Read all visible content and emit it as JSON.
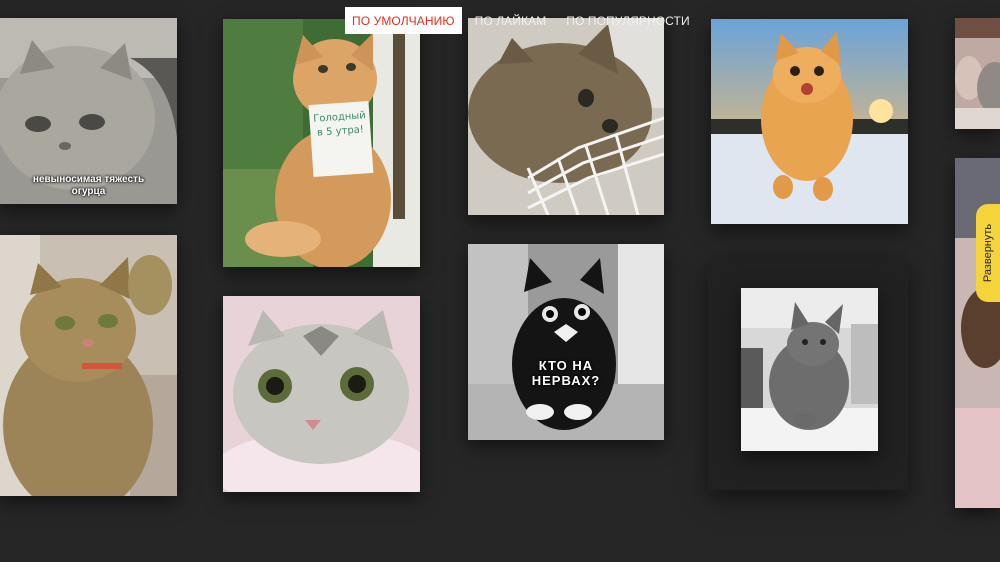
{
  "sort_tabs": [
    {
      "label": "ПО УМОЛЧАНИЮ",
      "active": true
    },
    {
      "label": "ПО ЛАЙКАМ",
      "active": false
    },
    {
      "label": "ПО ПОПУЛЯРНОСТИ",
      "active": false
    }
  ],
  "tiles": {
    "sad_cat": {
      "caption": "невыносимая тяжесть огурца"
    },
    "sign_cat": {
      "sign_text": "Голодный в 5 утра!"
    },
    "black_cat": {
      "caption": "КТО НА НЕРВАХ?"
    }
  },
  "expand_button": {
    "label": "Развернуть"
  },
  "colors": {
    "background": "#262626",
    "active_tab_text": "#d9321a",
    "expand_tab": "#f4d43a"
  }
}
